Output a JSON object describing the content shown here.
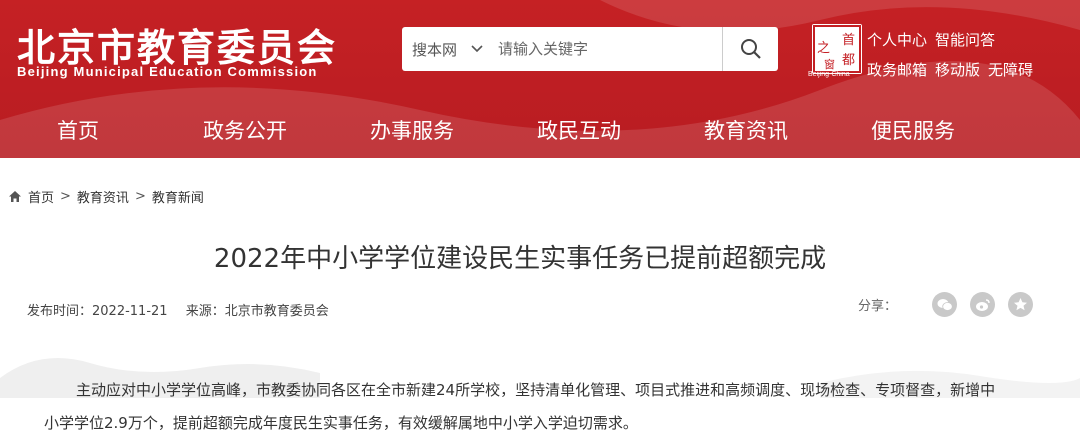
{
  "header": {
    "site_name_cn": "北京市教育委员会",
    "site_name_en": "Beijing Municipal Education Commission",
    "search": {
      "scope": "搜本网",
      "placeholder": "请输入关键字"
    },
    "seal": {
      "chars": [
        "首",
        "都",
        "之",
        "窗"
      ],
      "caption": "Beijing-China"
    },
    "links_row1": [
      "个人中心",
      "智能问答"
    ],
    "links_row2": [
      "政务邮箱",
      "移动版",
      "无障碍"
    ],
    "brand_color": "#c41f24"
  },
  "nav": [
    "首页",
    "政务公开",
    "办事服务",
    "政民互动",
    "教育资讯",
    "便民服务"
  ],
  "breadcrumb": [
    "首页",
    "教育资讯",
    "教育新闻"
  ],
  "article": {
    "title": "2022年中小学学位建设民生实事任务已提前超额完成",
    "publish_label": "发布时间：2022-11-21",
    "source_label": "来源：北京市教育委员会",
    "share_label": "分享：",
    "share_icons": [
      "wechat-icon",
      "weibo-icon",
      "favorite-icon"
    ],
    "body": "主动应对中小学学位高峰，市教委协同各区在全市新建24所学校，坚持清单化管理、项目式推进和高频调度、现场检查、专项督查，新增中小学学位2.9万个，提前超额完成年度民生实事任务，有效缓解属地中小学入学迫切需求。"
  }
}
